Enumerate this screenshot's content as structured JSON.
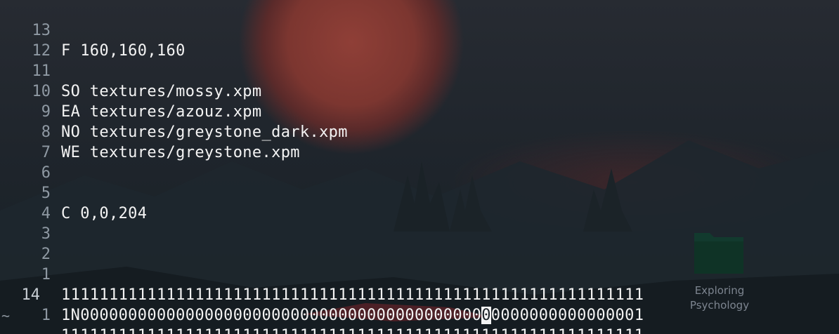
{
  "editor": {
    "lines": [
      {
        "number": "13",
        "text": "F 160,160,160"
      },
      {
        "number": "12",
        "text": ""
      },
      {
        "number": "11",
        "text": "SO textures/mossy.xpm"
      },
      {
        "number": "10",
        "text": "EA textures/azouz.xpm"
      },
      {
        "number": "9",
        "text": "NO textures/greystone_dark.xpm"
      },
      {
        "number": "8",
        "text": "WE textures/greystone.xpm"
      },
      {
        "number": "7",
        "text": ""
      },
      {
        "number": "6",
        "text": ""
      },
      {
        "number": "5",
        "text": "C 0,0,204"
      },
      {
        "number": "4",
        "text": ""
      },
      {
        "number": "3",
        "text": ""
      },
      {
        "number": "2",
        "text": ""
      },
      {
        "number": "1",
        "text": "1111111111111111111111111111111111111111111111111111111111111"
      },
      {
        "number": "14",
        "text_before_cursor": "1N000000000000000000000000000000000000000000",
        "cursor_char": "0",
        "text_after_cursor": "0000000000000001"
      },
      {
        "number": "1",
        "text": "1111111111111111111111111111111111111111111111111111111111111"
      }
    ],
    "end_of_buffer_marker": "~"
  },
  "desktop": {
    "icons": [
      {
        "label": "Exploring Psychology",
        "icon": "folder-icon"
      }
    ]
  },
  "colors": {
    "text": "#f4f4f4",
    "line_number": "#8f99a3",
    "moon": "#7c3630",
    "background": "#1f252c"
  }
}
